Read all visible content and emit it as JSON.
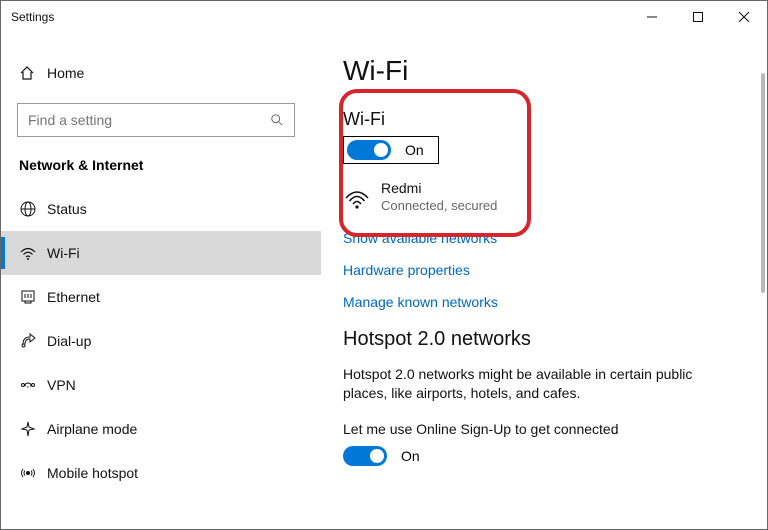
{
  "window": {
    "title": "Settings"
  },
  "sidebar": {
    "home_label": "Home",
    "search_placeholder": "Find a setting",
    "category": "Network & Internet",
    "items": [
      {
        "label": "Status"
      },
      {
        "label": "Wi-Fi"
      },
      {
        "label": "Ethernet"
      },
      {
        "label": "Dial-up"
      },
      {
        "label": "VPN"
      },
      {
        "label": "Airplane mode"
      },
      {
        "label": "Mobile hotspot"
      }
    ]
  },
  "content": {
    "page_title": "Wi-Fi",
    "wifi_section_title": "Wi-Fi",
    "wifi_toggle_label": "On",
    "network": {
      "name": "Redmi",
      "status": "Connected, secured"
    },
    "links": {
      "show_networks": "Show available networks",
      "hardware_properties": "Hardware properties",
      "manage_known": "Manage known networks"
    },
    "hotspot": {
      "title": "Hotspot 2.0 networks",
      "description": "Hotspot 2.0 networks might be available in certain public places, like airports, hotels, and cafes.",
      "osu_label": "Let me use Online Sign-Up to get connected",
      "osu_toggle_label": "On"
    }
  }
}
